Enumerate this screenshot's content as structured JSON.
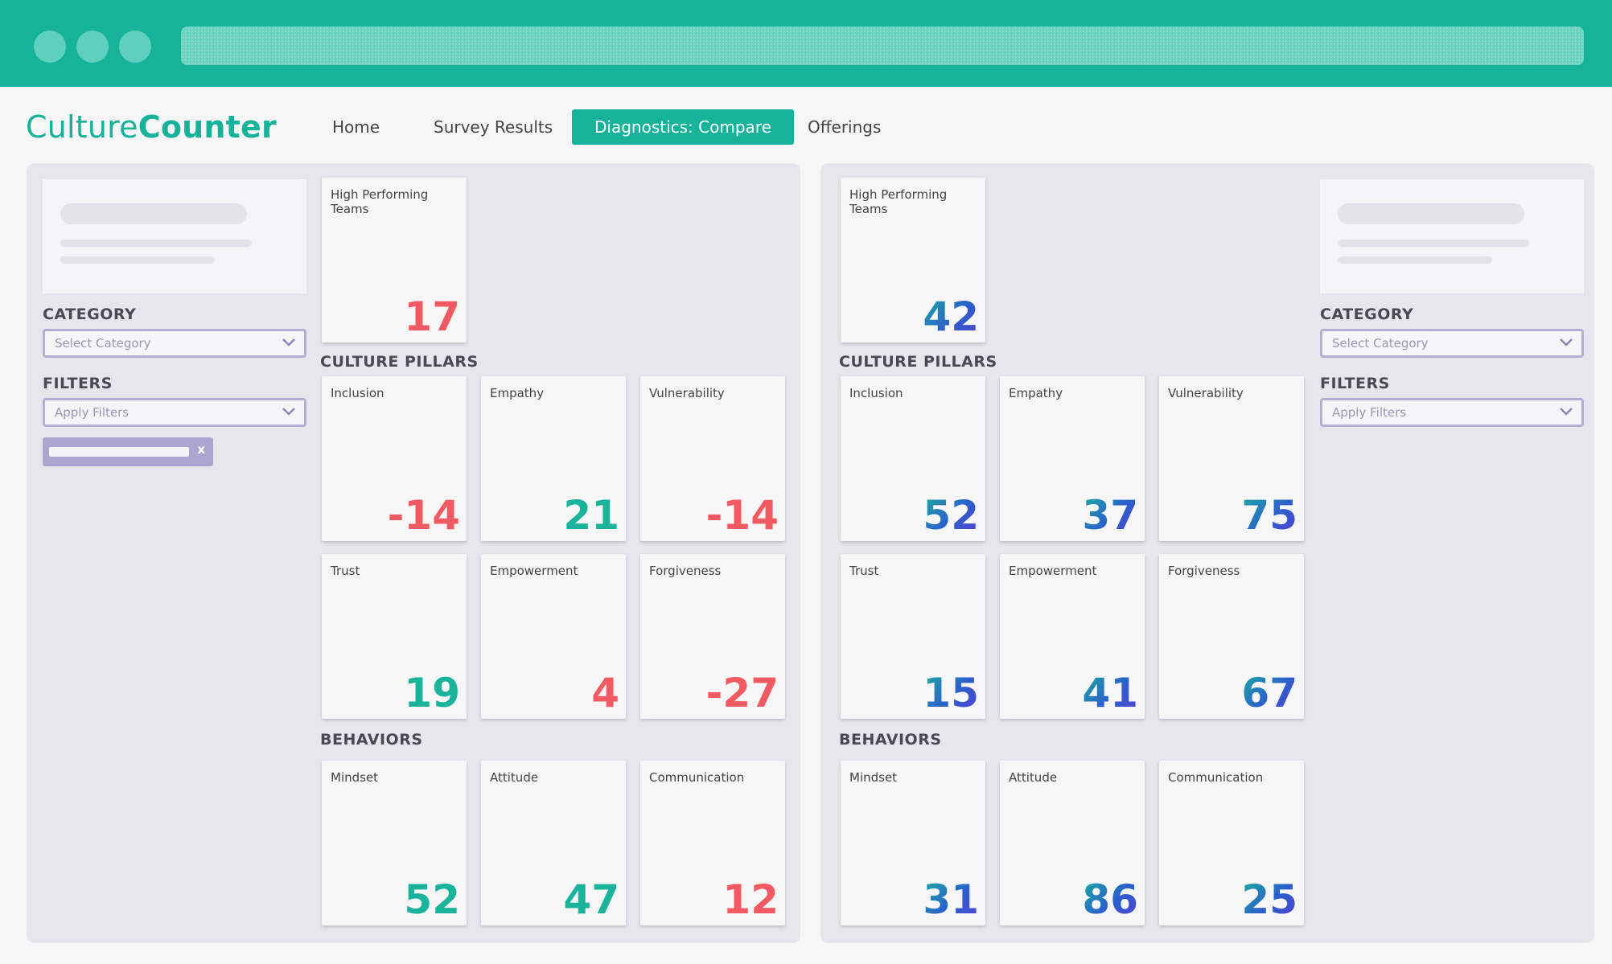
{
  "colors": {
    "brand": "#16b39a",
    "negative": "#f25a63",
    "positive": "#1ab39b",
    "compare_blue": "#2b63cc",
    "panel_bg": "#e6e6ed"
  },
  "app": {
    "logo_light": "Culture",
    "logo_bold": "Counter"
  },
  "nav": {
    "home": "Home",
    "survey_results": "Survey Results",
    "diagnostics_compare": "Diagnostics: Compare",
    "offerings": "Offerings"
  },
  "sidebar": {
    "category_label": "CATEGORY",
    "category_placeholder": "Select Category",
    "filters_label": "FILTERS",
    "filters_placeholder": "Apply Filters",
    "chip_remove": "x"
  },
  "left": {
    "high_performing": {
      "label": "High Performing Teams",
      "value": "17"
    },
    "culture_pillars_heading": "CULTURE PILLARS",
    "pillars": [
      {
        "label": "Inclusion",
        "value": "-14"
      },
      {
        "label": "Empathy",
        "value": "21"
      },
      {
        "label": "Vulnerability",
        "value": "-14"
      },
      {
        "label": "Trust",
        "value": "19"
      },
      {
        "label": "Empowerment",
        "value": "4"
      },
      {
        "label": "Forgiveness",
        "value": "-27"
      }
    ],
    "behaviors_heading": "BEHAVIORS",
    "behaviors": [
      {
        "label": "Mindset",
        "value": "52"
      },
      {
        "label": "Attitude",
        "value": "47"
      },
      {
        "label": "Communication",
        "value": "12"
      }
    ]
  },
  "right": {
    "high_performing": {
      "label": "High Performing Teams",
      "value": "42"
    },
    "culture_pillars_heading": "CULTURE PILLARS",
    "pillars": [
      {
        "label": "Inclusion",
        "value": "52"
      },
      {
        "label": "Empathy",
        "value": "37"
      },
      {
        "label": "Vulnerability",
        "value": "75"
      },
      {
        "label": "Trust",
        "value": "15"
      },
      {
        "label": "Empowerment",
        "value": "41"
      },
      {
        "label": "Forgiveness",
        "value": "67"
      }
    ],
    "behaviors_heading": "BEHAVIORS",
    "behaviors": [
      {
        "label": "Mindset",
        "value": "31"
      },
      {
        "label": "Attitude",
        "value": "86"
      },
      {
        "label": "Communication",
        "value": "25"
      }
    ]
  }
}
